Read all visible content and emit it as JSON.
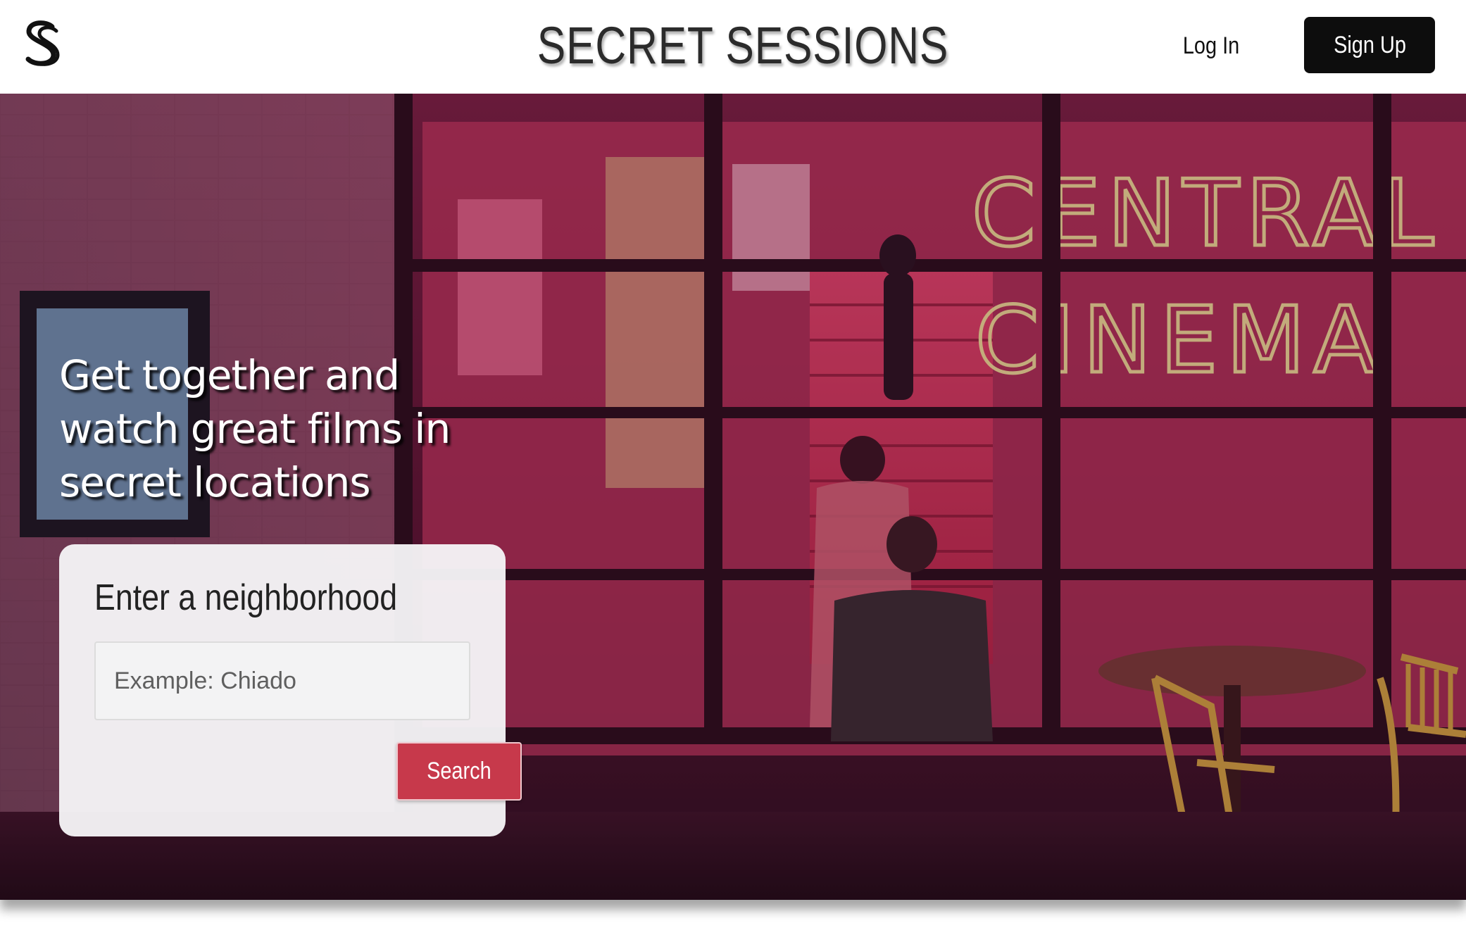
{
  "header": {
    "site_title": "SECRET SESSIONS",
    "login_label": "Log In",
    "signup_label": "Sign Up"
  },
  "hero": {
    "heading": "Get together and watch great films in secret locations",
    "search": {
      "label": "Enter a neighborhood",
      "placeholder": "Example: Chiado",
      "value": "",
      "button_label": "Search"
    }
  },
  "colors": {
    "header_bg": "#ffffff",
    "primary_button": "#0d0d0d",
    "accent_red": "#c7394b",
    "hero_tint": "#3a1325"
  },
  "icons": {
    "logo": "double-s-logo-icon"
  }
}
